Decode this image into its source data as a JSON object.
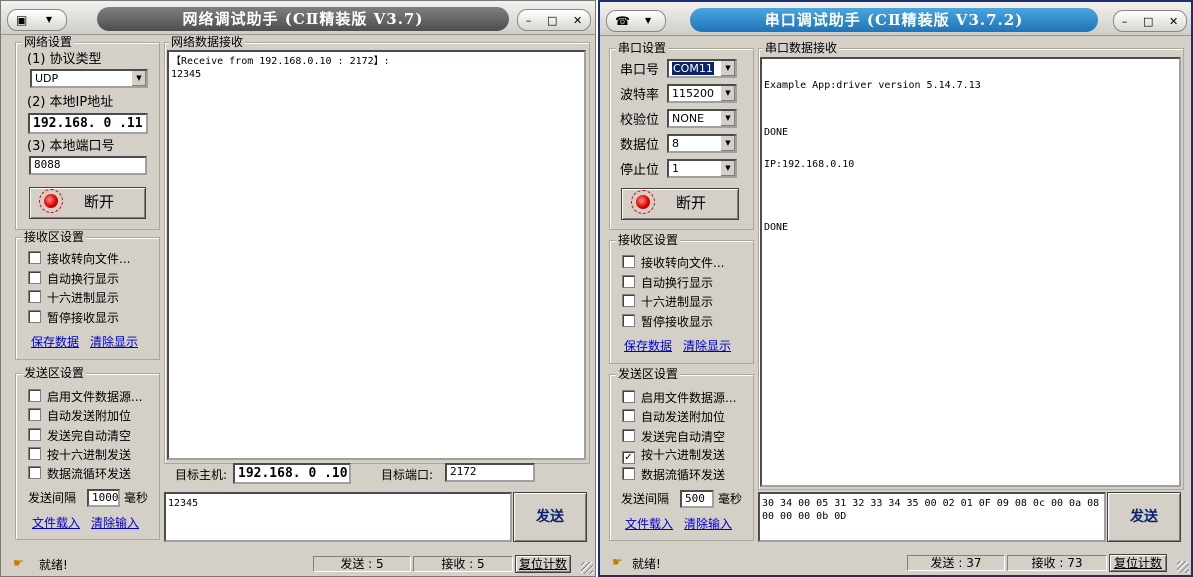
{
  "left": {
    "title": "网络调试助手 (CⅡ精装版 V3.7)",
    "net_settings": {
      "group_title": "网络设置",
      "protocol_label": "(1) 协议类型",
      "protocol_value": "UDP",
      "ip_label": "(2) 本地IP地址",
      "ip_value": "192.168. 0 .11",
      "port_label": "(3) 本地端口号",
      "port_value": "8088",
      "open_button": "断开"
    },
    "recv_settings": {
      "group_title": "接收区设置",
      "options": [
        "接收转向文件...",
        "自动换行显示",
        "十六进制显示",
        "暂停接收显示"
      ],
      "save_link": "保存数据",
      "clear_link": "清除显示"
    },
    "send_settings": {
      "group_title": "发送区设置",
      "options": [
        "启用文件数据源...",
        "自动发送附加位",
        "发送完自动清空",
        "按十六进制发送",
        "数据流循环发送"
      ],
      "interval_label": "发送间隔",
      "interval_value": "1000",
      "interval_unit": "毫秒",
      "load_link": "文件载入",
      "clear_link": "清除输入"
    },
    "recv_area": {
      "group_title": "网络数据接收",
      "lines": [
        "【Receive from 192.168.0.10 : 2172】:",
        "12345"
      ]
    },
    "target": {
      "host_label": "目标主机:",
      "host_value": "192.168. 0 .10",
      "port_label": "目标端口:",
      "port_value": "2172"
    },
    "send_text": "12345",
    "send_button": "发送",
    "status": {
      "ready": "就绪!",
      "sent": "发送 : 5",
      "received": "接收 : 5",
      "reset": "复位计数"
    }
  },
  "right": {
    "title": "串口调试助手 (CⅡ精装版 V3.7.2)",
    "serial_settings": {
      "group_title": "串口设置",
      "port_label": "串口号",
      "port_value": "COM11",
      "baud_label": "波特率",
      "baud_value": "115200",
      "parity_label": "校验位",
      "parity_value": "NONE",
      "data_label": "数据位",
      "data_value": "8",
      "stop_label": "停止位",
      "stop_value": "1",
      "open_button": "断开"
    },
    "recv_settings": {
      "group_title": "接收区设置",
      "options": [
        "接收转向文件...",
        "自动换行显示",
        "十六进制显示",
        "暂停接收显示"
      ],
      "save_link": "保存数据",
      "clear_link": "清除显示"
    },
    "send_settings": {
      "group_title": "发送区设置",
      "options": [
        "启用文件数据源...",
        "自动发送附加位",
        "发送完自动清空",
        "按十六进制发送",
        "数据流循环发送"
      ],
      "hex_send_checked": "✓",
      "interval_label": "发送间隔",
      "interval_value": "500",
      "interval_unit": "毫秒",
      "load_link": "文件载入",
      "clear_link": "清除输入"
    },
    "recv_area": {
      "group_title": "串口数据接收",
      "lines": [
        "Example App:driver version 5.14.7.13",
        "DONE",
        "IP:192.168.0.10",
        "DONE"
      ]
    },
    "send_text": [
      "30 34 00 05 31 32 33 34 35 00 02 01 0F 09 08 0c 00 0a 08",
      "00 00 00 0b 0D"
    ],
    "send_button": "发送",
    "status": {
      "ready": "就绪!",
      "sent": "发送 : 37",
      "received": "接收 : 73",
      "reset": "复位计数"
    }
  },
  "colors": {
    "window_bg": "#d4d0c8",
    "left_title_bg": "#5e5e5e",
    "right_title_bg": "#2a86cc",
    "link": "#0000cc",
    "led": "#e00000",
    "right_border": "#1c2f6e"
  }
}
